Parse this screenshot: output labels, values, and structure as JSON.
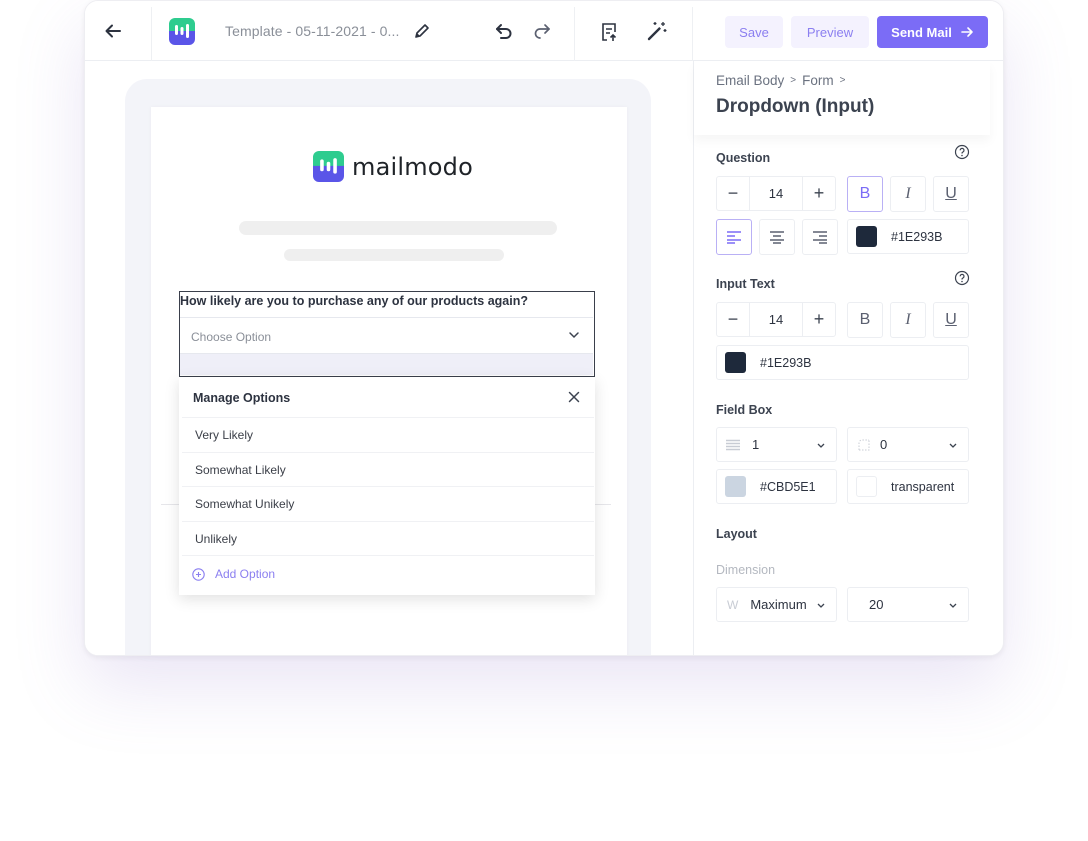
{
  "toolbar": {
    "title": "Template - 05-11-2021 - 0...",
    "save_label": "Save",
    "preview_label": "Preview",
    "send_label": "Send Mail",
    "icons": [
      "arrow-left-icon",
      "mailmodo-logo",
      "pencil-icon",
      "undo-icon",
      "redo-icon",
      "document-upload-icon",
      "magic-wand-icon",
      "arrow-right-icon"
    ]
  },
  "email": {
    "brand_name": "mailmodo",
    "question": "How likely are you to purchase any of our products again?",
    "select_placeholder": "Choose Option"
  },
  "options_panel": {
    "title": "Manage Options",
    "options": [
      "Very Likely",
      "Somewhat Likely",
      "Somewhat Unikely",
      "Unlikely"
    ],
    "add_label": "Add Option"
  },
  "panel": {
    "breadcrumb": [
      "Email Body",
      "Form"
    ],
    "title": "Dropdown (Input)",
    "question": {
      "label": "Question",
      "font_size": "14",
      "bold": "B",
      "italic": "I",
      "underline": "U",
      "bold_active": true,
      "align_active": "left",
      "color": "#1E293B"
    },
    "input_text": {
      "label": "Input Text",
      "font_size": "14",
      "bold": "B",
      "italic": "I",
      "underline": "U",
      "color": "#1E293B"
    },
    "field_box": {
      "label": "Field Box",
      "border_width": "1",
      "border_radius": "0",
      "border_color": "#CBD5E1",
      "background": "transparent"
    },
    "layout": {
      "label": "Layout",
      "dimension_label": "Dimension",
      "width_prefix": "W",
      "width_value": "Maximum",
      "size_value": "20"
    }
  },
  "colors": {
    "accent": "#7B6CF6",
    "accent_light": "#F4F2FE",
    "text_color_swatch": "#1E293B",
    "border_swatch": "#CBD5E1",
    "logo_green": "#2ECC8F",
    "logo_purple": "#5A55E8"
  }
}
